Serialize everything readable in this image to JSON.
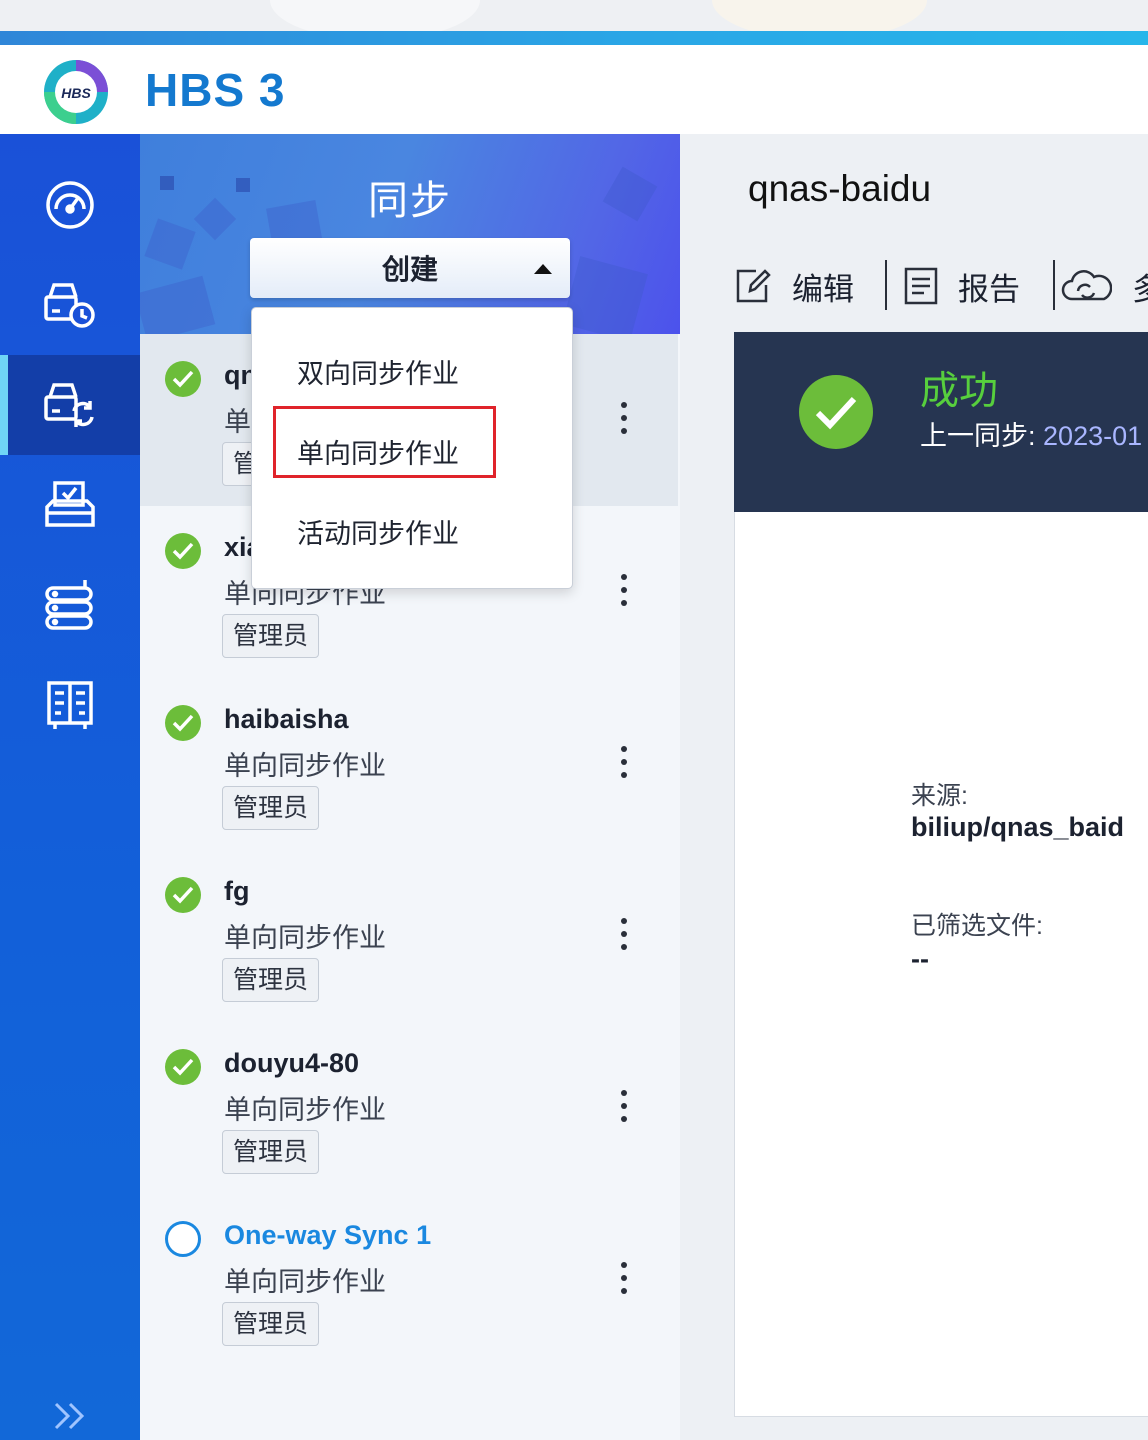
{
  "app": {
    "title": "HBS 3",
    "logo_text": "HBS"
  },
  "rail": {
    "items": [
      {
        "icon": "dashboard-icon",
        "active": false
      },
      {
        "icon": "backup-restore-icon",
        "active": false
      },
      {
        "icon": "sync-icon",
        "active": true
      },
      {
        "icon": "jobs-tray-icon",
        "active": false
      },
      {
        "icon": "storage-server-icon",
        "active": false
      },
      {
        "icon": "services-cabinet-icon",
        "active": false
      }
    ],
    "expand_icon": "double-chevron-right-icon"
  },
  "list": {
    "section_title": "同步",
    "create_button": "创建",
    "jobs": [
      {
        "name": "qnas-baidu",
        "type": "单向同步作业",
        "tag": "管理员",
        "status": "success",
        "selected": true
      },
      {
        "name": "xiaohongshu",
        "type": "单向同步作业",
        "tag": "管理员",
        "status": "success",
        "selected": false
      },
      {
        "name": "haibaisha",
        "type": "单向同步作业",
        "tag": "管理员",
        "status": "success",
        "selected": false
      },
      {
        "name": "fg",
        "type": "单向同步作业",
        "tag": "管理员",
        "status": "success",
        "selected": false
      },
      {
        "name": "douyu4-80",
        "type": "单向同步作业",
        "tag": "管理员",
        "status": "success",
        "selected": false
      },
      {
        "name": "One-way Sync 1",
        "type": "单向同步作业",
        "tag": "管理员",
        "status": "pending",
        "selected": false
      }
    ]
  },
  "dropdown": {
    "items": [
      "双向同步作业",
      "单向同步作业",
      "活动同步作业"
    ],
    "highlighted_index": 1
  },
  "detail": {
    "title": "qnas-baidu",
    "toolbar": {
      "edit": "编辑",
      "report": "报告",
      "more": "多"
    },
    "status": {
      "word": "成功",
      "last_sync_label": "上一同步:",
      "last_sync_value": "2023-01"
    },
    "source_label": "来源:",
    "source_value": "biliup/qnas_baid",
    "filtered_label": "已筛选文件:",
    "filtered_value": "--"
  },
  "colors": {
    "brand_blue": "#1479cf",
    "rail_blue": "#1260d9",
    "success_green": "#6cbd3a",
    "status_card": "#263551",
    "highlight_red": "#e0232a"
  }
}
